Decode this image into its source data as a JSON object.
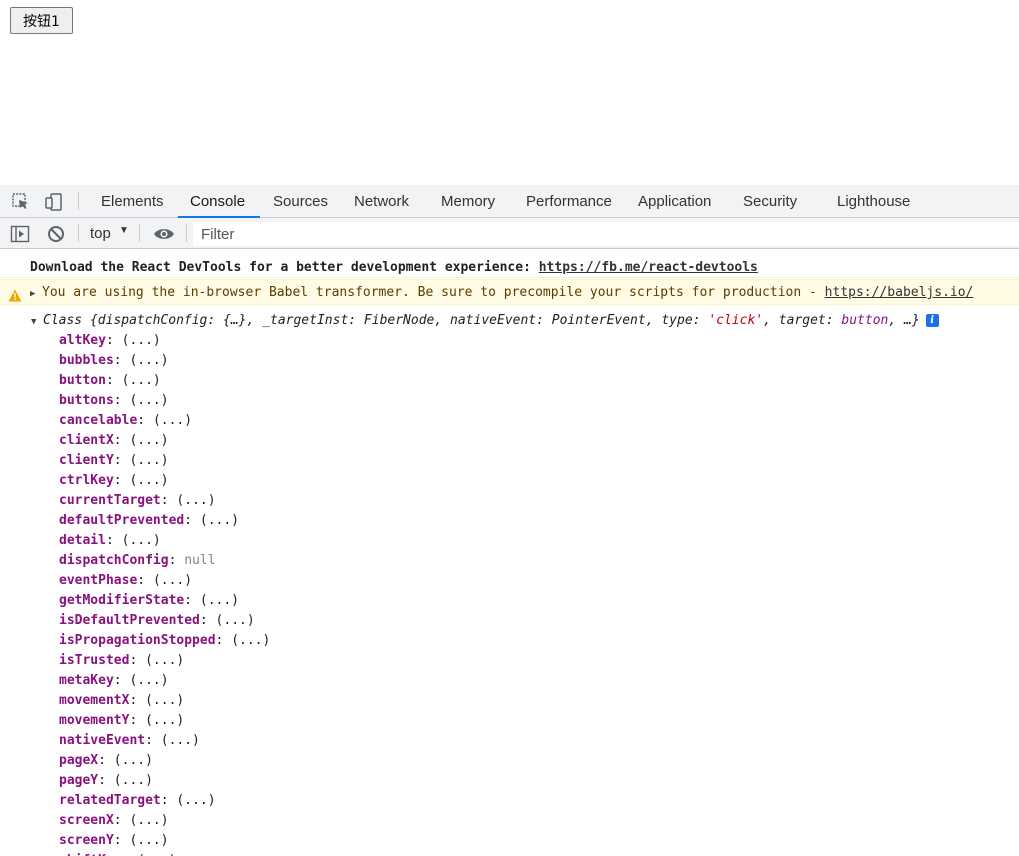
{
  "page": {
    "button_label": "按钮1"
  },
  "devtools": {
    "tabs": [
      {
        "label": "Elements"
      },
      {
        "label": "Console"
      },
      {
        "label": "Sources"
      },
      {
        "label": "Network"
      },
      {
        "label": "Memory"
      },
      {
        "label": "Performance"
      },
      {
        "label": "Application"
      },
      {
        "label": "Security"
      },
      {
        "label": "Lighthouse"
      }
    ],
    "active_tab": "Console",
    "toolbar": {
      "context": "top",
      "filter_placeholder": "Filter"
    },
    "colors": {
      "accent": "#1a73e8",
      "warning_bg": "#fffbe5",
      "property_key": "#881280",
      "string_value": "#c80000"
    }
  },
  "console": {
    "info_message": {
      "text": "Download the React DevTools for a better development experience: ",
      "link": "https://fb.me/react-devtools"
    },
    "warning_message": {
      "text": "You are using the in-browser Babel transformer. Be sure to precompile your scripts for production - ",
      "link": "https://babeljs.io/"
    },
    "object_summary": {
      "class_name": "Class",
      "open_brace": "{",
      "p1_key": "dispatchConfig",
      "p1_val": "{…}",
      "p2_key": "_targetInst",
      "p2_val": "FiberNode",
      "p3_key": "nativeEvent",
      "p3_val": "PointerEvent",
      "p4_key": "type",
      "p4_val": "'click'",
      "p5_key": "target",
      "p5_val": "button",
      "tail": "…}",
      "info_badge": "i"
    },
    "properties": [
      {
        "key": "altKey",
        "value": "(...)"
      },
      {
        "key": "bubbles",
        "value": "(...)"
      },
      {
        "key": "button",
        "value": "(...)"
      },
      {
        "key": "buttons",
        "value": "(...)"
      },
      {
        "key": "cancelable",
        "value": "(...)"
      },
      {
        "key": "clientX",
        "value": "(...)"
      },
      {
        "key": "clientY",
        "value": "(...)"
      },
      {
        "key": "ctrlKey",
        "value": "(...)"
      },
      {
        "key": "currentTarget",
        "value": "(...)"
      },
      {
        "key": "defaultPrevented",
        "value": "(...)"
      },
      {
        "key": "detail",
        "value": "(...)"
      },
      {
        "key": "dispatchConfig",
        "value": "null"
      },
      {
        "key": "eventPhase",
        "value": "(...)"
      },
      {
        "key": "getModifierState",
        "value": "(...)"
      },
      {
        "key": "isDefaultPrevented",
        "value": "(...)"
      },
      {
        "key": "isPropagationStopped",
        "value": "(...)"
      },
      {
        "key": "isTrusted",
        "value": "(...)"
      },
      {
        "key": "metaKey",
        "value": "(...)"
      },
      {
        "key": "movementX",
        "value": "(...)"
      },
      {
        "key": "movementY",
        "value": "(...)"
      },
      {
        "key": "nativeEvent",
        "value": "(...)"
      },
      {
        "key": "pageX",
        "value": "(...)"
      },
      {
        "key": "pageY",
        "value": "(...)"
      },
      {
        "key": "relatedTarget",
        "value": "(...)"
      },
      {
        "key": "screenX",
        "value": "(...)"
      },
      {
        "key": "screenY",
        "value": "(...)"
      },
      {
        "key": "shiftKey",
        "value": "(...)"
      }
    ]
  }
}
